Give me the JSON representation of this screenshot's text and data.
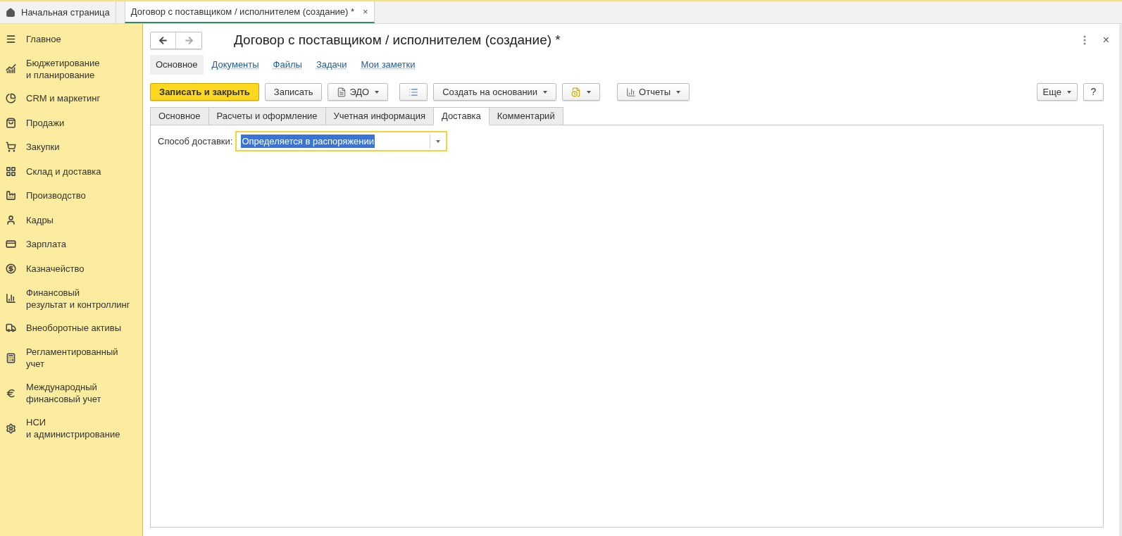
{
  "top_tabs": [
    {
      "label": "Начальная страница",
      "selected": false,
      "kind": "home"
    },
    {
      "label": "Договор с поставщиком / исполнителем (создание) *",
      "selected": true,
      "kind": "doc",
      "close": "×"
    }
  ],
  "sidebar": {
    "items": [
      {
        "label": "Главное"
      },
      {
        "label": "Бюджетирование\nи планирование"
      },
      {
        "label": "CRM и маркетинг"
      },
      {
        "label": "Продажи"
      },
      {
        "label": "Закупки"
      },
      {
        "label": "Склад и доставка"
      },
      {
        "label": "Производство"
      },
      {
        "label": "Кадры"
      },
      {
        "label": "Зарплата"
      },
      {
        "label": "Казначейство"
      },
      {
        "label": "Финансовый\nрезультат и контроллинг"
      },
      {
        "label": "Внеоборотные активы"
      },
      {
        "label": "Регламентированный\nучет"
      },
      {
        "label": "Международный\nфинансовый учет"
      },
      {
        "label": "НСИ\nи администрирование"
      }
    ]
  },
  "form": {
    "title": "Договор с поставщиком / исполнителем (создание) *",
    "close": "×",
    "nav_links": [
      {
        "label": "Основное",
        "selected": true
      },
      {
        "label": "Документы",
        "selected": false
      },
      {
        "label": "Файлы",
        "selected": false
      },
      {
        "label": "Задачи",
        "selected": false
      },
      {
        "label": "Мои заметки",
        "selected": false
      }
    ],
    "toolbar": [
      {
        "kind": "primary",
        "label": "Записать и закрыть"
      },
      {
        "kind": "button",
        "label": "Записать"
      },
      {
        "kind": "edo",
        "label": "ЭДО"
      },
      {
        "kind": "list-icon"
      },
      {
        "kind": "dropdown",
        "label": "Создать на основании"
      },
      {
        "kind": "doc-icon"
      },
      {
        "kind": "reports",
        "label": "Отчеты"
      }
    ],
    "more": "Еще",
    "help": "?",
    "tabs": [
      {
        "label": "Основное",
        "selected": false
      },
      {
        "label": "Расчеты и оформление",
        "selected": false
      },
      {
        "label": "Учетная информация",
        "selected": false
      },
      {
        "label": "Доставка",
        "selected": true
      },
      {
        "label": "Комментарий",
        "selected": false
      }
    ],
    "field": {
      "label": "Способ доставки:",
      "value": "Определяется в распоряжении"
    }
  }
}
